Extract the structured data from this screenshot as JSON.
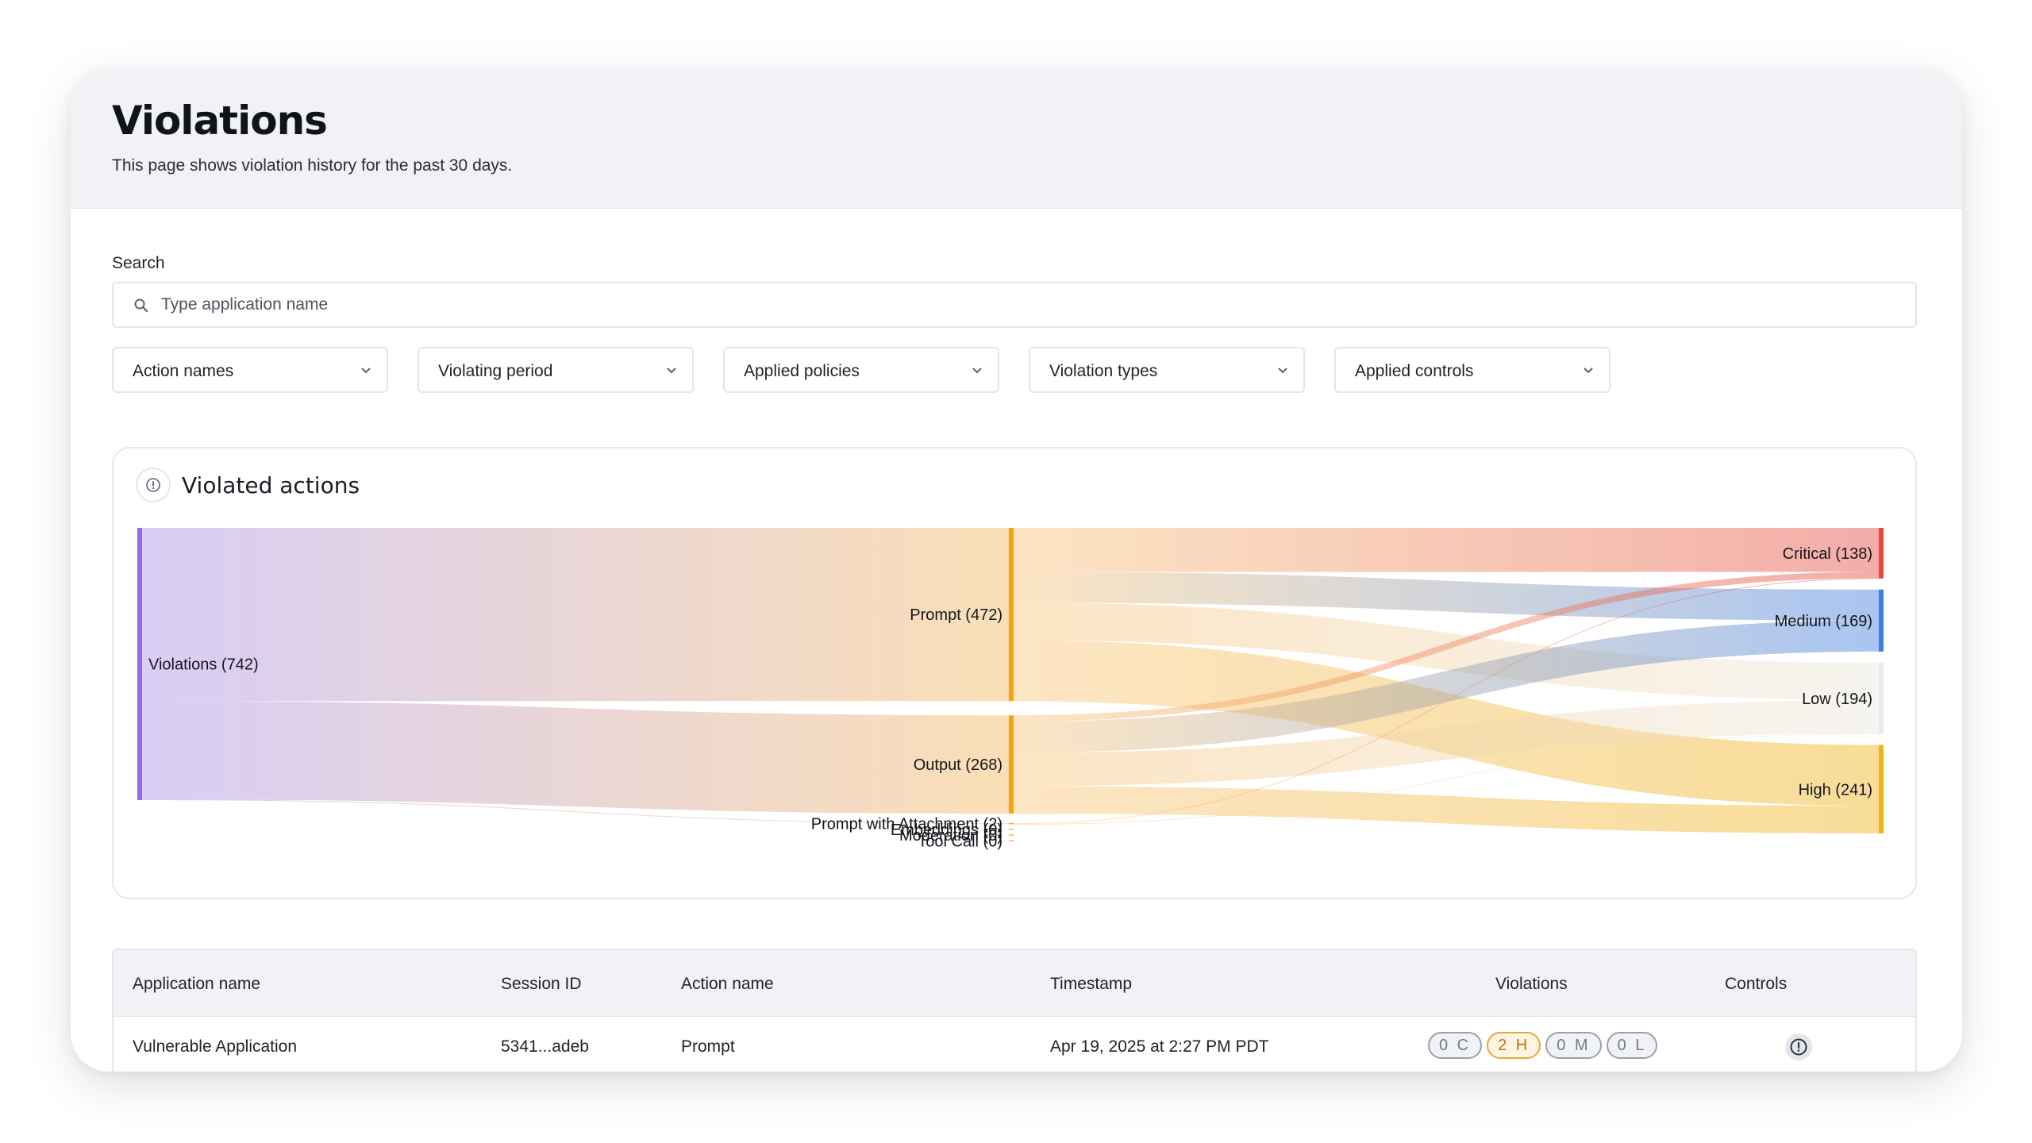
{
  "header": {
    "title": "Violations",
    "subtitle": "This page shows violation history for the past 30 days."
  },
  "search": {
    "label": "Search",
    "placeholder": "Type application name",
    "value": "",
    "icon": "search-icon"
  },
  "filters": [
    {
      "label": "Action names"
    },
    {
      "label": "Violating period"
    },
    {
      "label": "Applied policies"
    },
    {
      "label": "Violation types"
    },
    {
      "label": "Applied controls"
    }
  ],
  "chart_card": {
    "title": "Violated actions",
    "icon": "info-icon"
  },
  "chart_data": {
    "type": "sankey",
    "nodes": [
      {
        "id": "violations",
        "label": "Violations (742)",
        "value": 742,
        "column": 0,
        "color": "#8f6fe0"
      },
      {
        "id": "prompt",
        "label": "Prompt (472)",
        "value": 472,
        "column": 1,
        "color": "#f5a21a"
      },
      {
        "id": "output",
        "label": "Output (268)",
        "value": 268,
        "column": 1,
        "color": "#f5a21a"
      },
      {
        "id": "prompt_attach",
        "label": "Prompt with Attachment (2)",
        "value": 2,
        "column": 1,
        "color": "#f5a21a"
      },
      {
        "id": "embeddings",
        "label": "Embeddings (0)",
        "value": 0,
        "column": 1,
        "color": "#f5a21a"
      },
      {
        "id": "moderation",
        "label": "Moderation (0)",
        "value": 0,
        "column": 1,
        "color": "#f5a21a"
      },
      {
        "id": "tool_call",
        "label": "Tool Call (0)",
        "value": 0,
        "column": 1,
        "color": "#f5a21a"
      },
      {
        "id": "critical",
        "label": "Critical (138)",
        "value": 138,
        "column": 2,
        "color": "#e5483f"
      },
      {
        "id": "medium",
        "label": "Medium (169)",
        "value": 169,
        "column": 2,
        "color": "#3f7de0"
      },
      {
        "id": "low",
        "label": "Low (194)",
        "value": 194,
        "column": 2,
        "color": "#e9e9ee"
      },
      {
        "id": "high",
        "label": "High (241)",
        "value": 241,
        "column": 2,
        "color": "#f0b21a"
      }
    ],
    "links": [
      {
        "source": "violations",
        "target": "prompt",
        "value": 472
      },
      {
        "source": "violations",
        "target": "output",
        "value": 268
      },
      {
        "source": "violations",
        "target": "prompt_attach",
        "value": 2
      },
      {
        "source": "prompt",
        "target": "critical",
        "value": 120
      },
      {
        "source": "prompt",
        "target": "medium",
        "value": 84
      },
      {
        "source": "prompt",
        "target": "low",
        "value": 102
      },
      {
        "source": "prompt",
        "target": "high",
        "value": 166
      },
      {
        "source": "output",
        "target": "critical",
        "value": 17
      },
      {
        "source": "output",
        "target": "medium",
        "value": 85
      },
      {
        "source": "output",
        "target": "low",
        "value": 91
      },
      {
        "source": "output",
        "target": "high",
        "value": 75
      },
      {
        "source": "prompt_attach",
        "target": "critical",
        "value": 1
      },
      {
        "source": "prompt_attach",
        "target": "low",
        "value": 1
      }
    ]
  },
  "table": {
    "columns": [
      "Application name",
      "Session ID",
      "Action name",
      "Timestamp",
      "Violations",
      "Controls"
    ],
    "settings_icon": "gear-icon",
    "rows": [
      {
        "application_name": "Vulnerable Application",
        "session_id": "5341...adeb",
        "action_name": "Prompt",
        "timestamp": "Apr 19, 2025 at 2:27 PM PDT",
        "violations": [
          "0 C",
          "2 H",
          "0 M",
          "0 L"
        ],
        "control_icon": "alert-circle-icon",
        "menu_icon": "kebab-menu-icon"
      }
    ]
  },
  "colors": {
    "header_bg": "#f1f2f5",
    "high_badge": "#e8a93b",
    "critical": "#e5483f",
    "medium": "#3f7de0",
    "high": "#f0b21a",
    "prompt": "#f5a21a",
    "violations": "#8f6fe0"
  }
}
